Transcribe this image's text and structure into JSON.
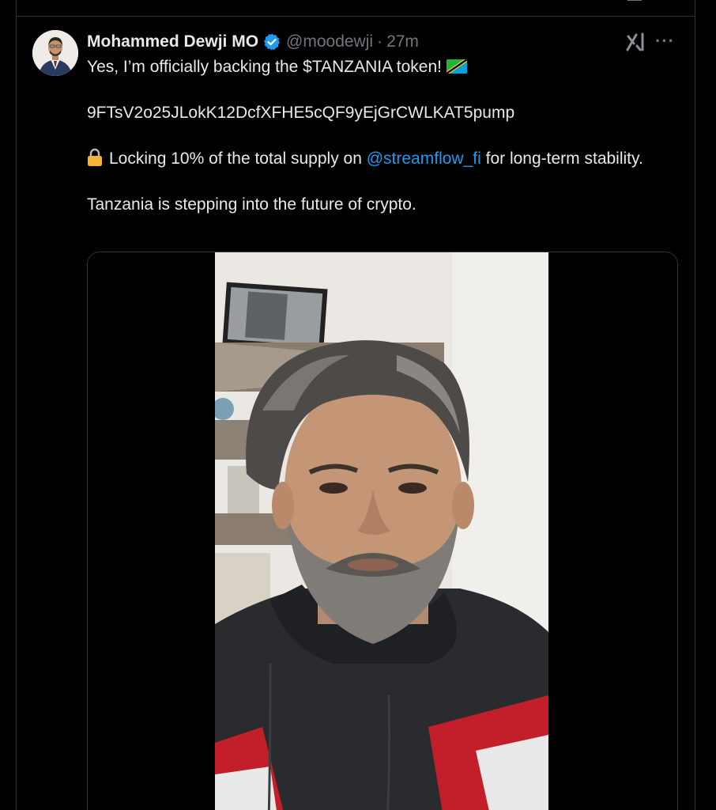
{
  "tweet": {
    "author_name": "Mohammed Dewji MO",
    "handle": "@moodewji",
    "separator": "·",
    "time": "27m",
    "line1": "Yes, I’m officially backing the $TANZANIA token!",
    "contract": "9FTsV2o25JLokK12DcfXFHE5cQF9yEjGrCWLKAT5pump",
    "lock_text_before": "Locking 10% of the total supply on",
    "mention": "@streamflow_fi",
    "lock_text_after": "for long-term stability.",
    "closing": "Tanzania is stepping into the future of crypto."
  },
  "icons": {
    "verified": "verified-badge-icon",
    "grok": "grok-icon",
    "more": "more-icon",
    "flag": "tanzania-flag-icon",
    "lock": "lock-icon"
  },
  "colors": {
    "background": "#000000",
    "text": "#e7e9ea",
    "muted": "#71767b",
    "link": "#1d9bf0",
    "border": "#2f3336",
    "verified": "#1d9bf0"
  }
}
